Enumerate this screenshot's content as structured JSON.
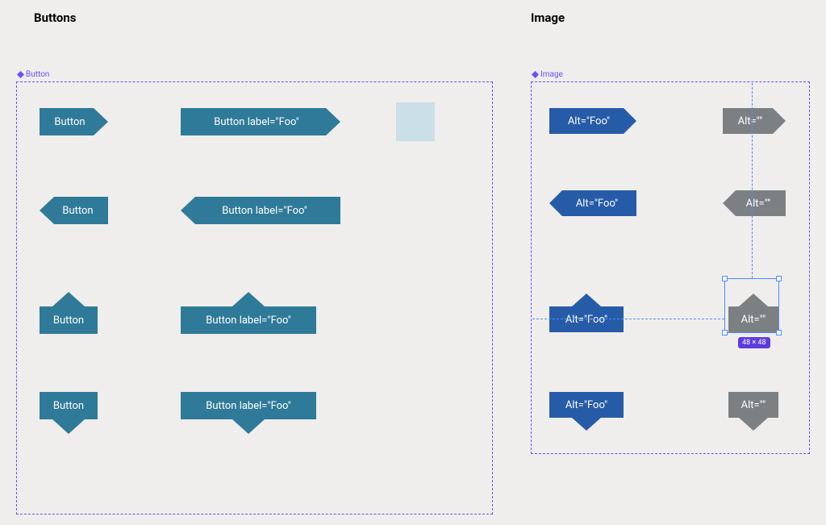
{
  "sections": {
    "buttons_title": "Buttons",
    "image_title": "Image"
  },
  "frame_labels": {
    "button": "Button",
    "image": "Image"
  },
  "button_grid": {
    "col1_label": "Button",
    "col2_label": "Button label=\"Foo\""
  },
  "image_grid": {
    "col1_label": "Alt=\"Foo\"",
    "col2_label": "Alt=\"\""
  },
  "selection": {
    "dim_badge": "48 × 48"
  },
  "colors": {
    "teal": "#2f7a99",
    "blue": "#265ba8",
    "gray": "#7d8083",
    "pale": "#cadfe8",
    "accent": "#6b4eff"
  }
}
